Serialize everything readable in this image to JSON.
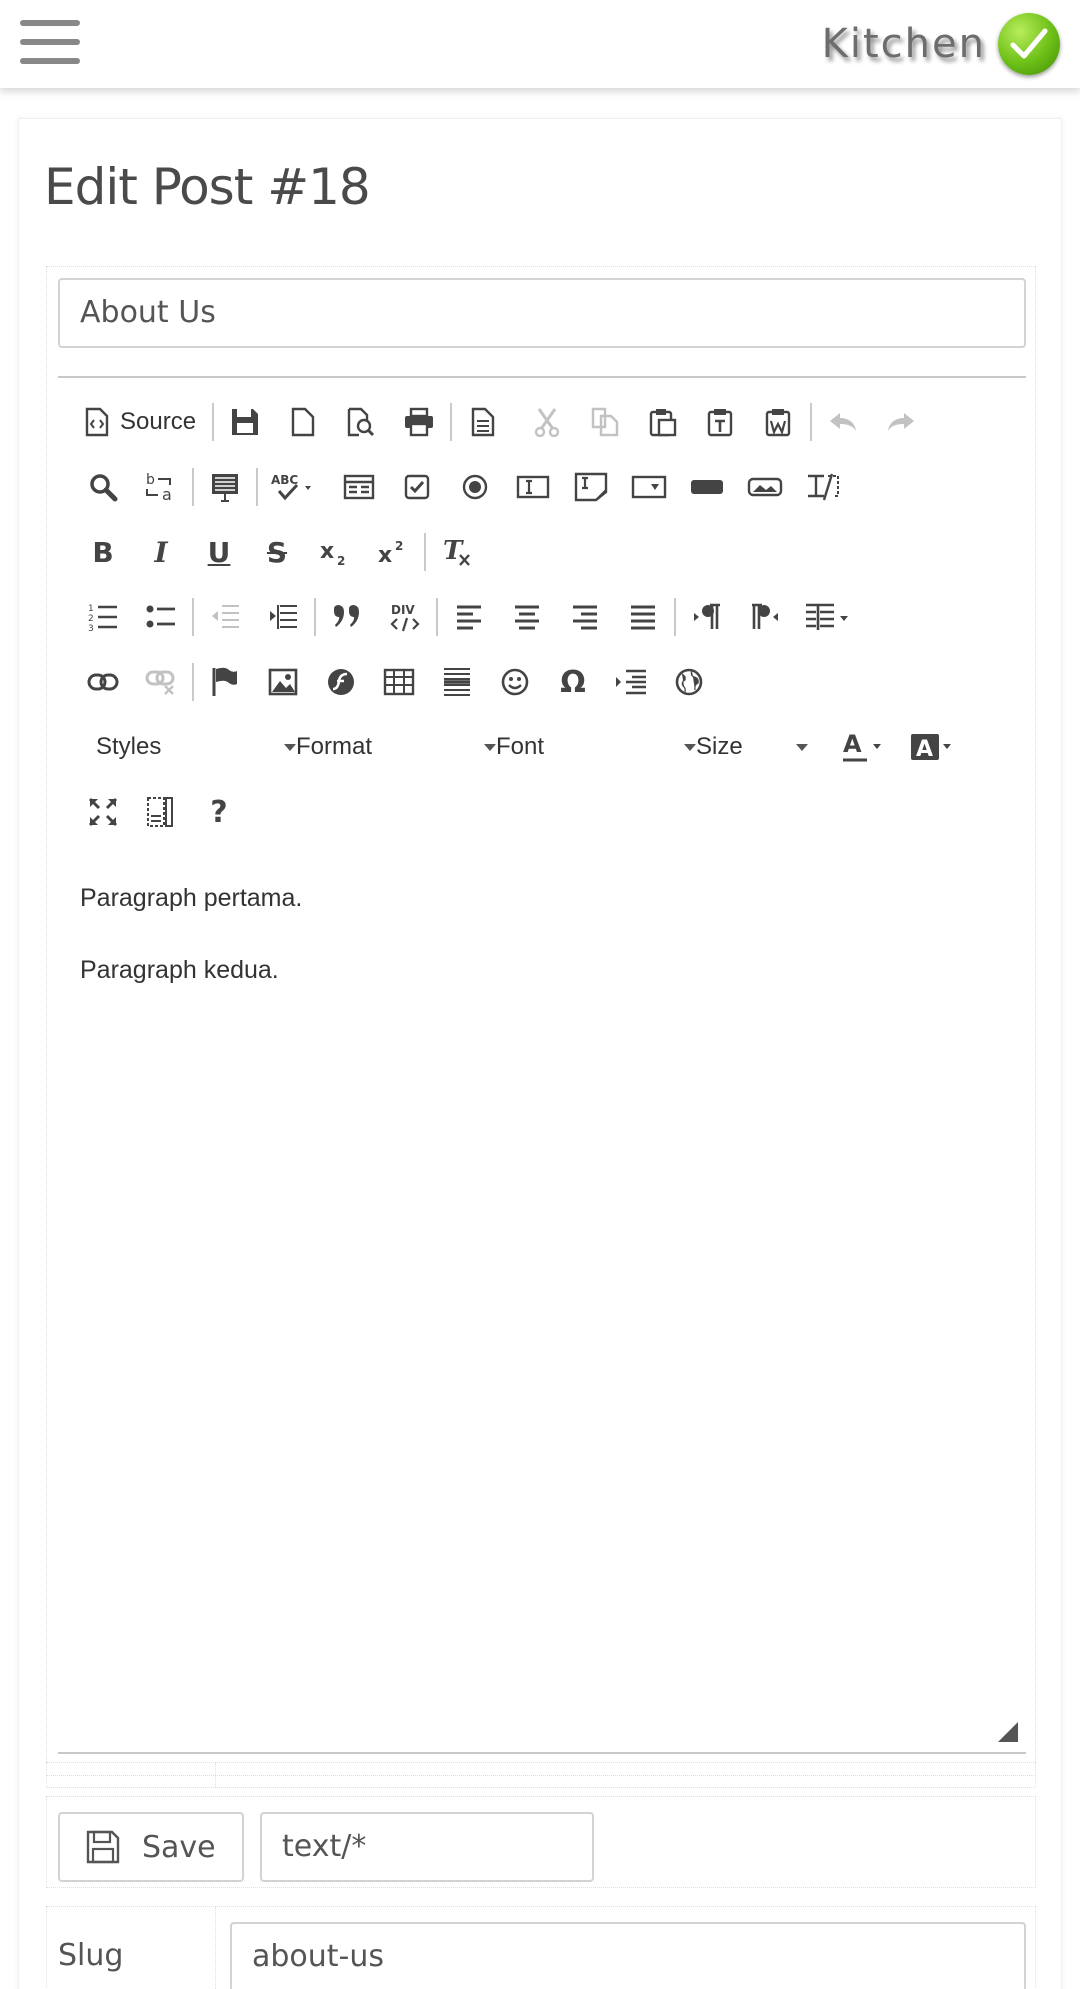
{
  "header": {
    "brand": "Kitchen",
    "badge_color": "#6cbf17"
  },
  "page": {
    "title": "Edit Post #18"
  },
  "post": {
    "title_value": "About Us",
    "mime_value": "text/*",
    "slug_label": "Slug",
    "slug_value": "about-us",
    "save_label": "Save"
  },
  "editor": {
    "source_label": "Source",
    "combos": {
      "styles": "Styles",
      "format": "Format",
      "font": "Font",
      "size": "Size"
    },
    "spellcheck_label": "ABC",
    "div_label": "DIV",
    "content": [
      "Paragraph pertama.",
      "Paragraph kedua."
    ]
  }
}
